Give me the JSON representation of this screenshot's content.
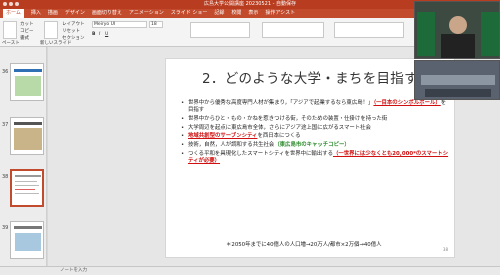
{
  "window": {
    "title": "広島大学公開講座 20230521 - 自動保存"
  },
  "ribbon_tabs": [
    "ホーム",
    "挿入",
    "描画",
    "デザイン",
    "画面切り替え",
    "アニメーション",
    "スライド ショー",
    "記録",
    "校閲",
    "表示",
    "操作アシスト"
  ],
  "active_tab_index": 0,
  "ribbon": {
    "paste": "ペースト",
    "cut": "カット",
    "copy": "コピー",
    "format": "書式",
    "new_slide": "新しいスライド",
    "layout": "レイアウト",
    "reset": "リセット",
    "section": "セクション",
    "font": "Meiryo UI",
    "size": "18"
  },
  "thumbnails": [
    {
      "num": "36"
    },
    {
      "num": "37"
    },
    {
      "num": "38",
      "selected": true
    },
    {
      "num": "39"
    }
  ],
  "slide": {
    "title": "2．どのような大学・まちを目指す？",
    "bullets": [
      {
        "pre": "世界中から優秀な高度専門人材が集まり，「アジアで起業するなら東広島！」",
        "red": "（一目本のシンボルポール）",
        "post": "を目指す"
      },
      {
        "text": "世界中からひと・もの・かねを惹きつける街，そのための装置・仕掛けを持った街"
      },
      {
        "text": "大学周辺を起点に東広島市全体，さらにアジア途上国に広がるスマート社会"
      },
      {
        "red": "地域共創型のサーブンシティ",
        "post": "を西日本につくる"
      },
      {
        "pre": "技術，自然，人が調和する共生社会",
        "green": "（東広島市のキャッチコピー）"
      },
      {
        "pre": "つくる平和を具現化したスマートシティを世界中に輸出する",
        "red": "（一世界には少なくとも20,000*のスマートシティが必要）"
      }
    ],
    "footnote": "＊2050年までに40億人の人口増→20万人/都市×2万個→40億人",
    "page_number": "38"
  },
  "status": {
    "notes": "ノートを入力"
  },
  "video": {
    "label": "参加者"
  }
}
